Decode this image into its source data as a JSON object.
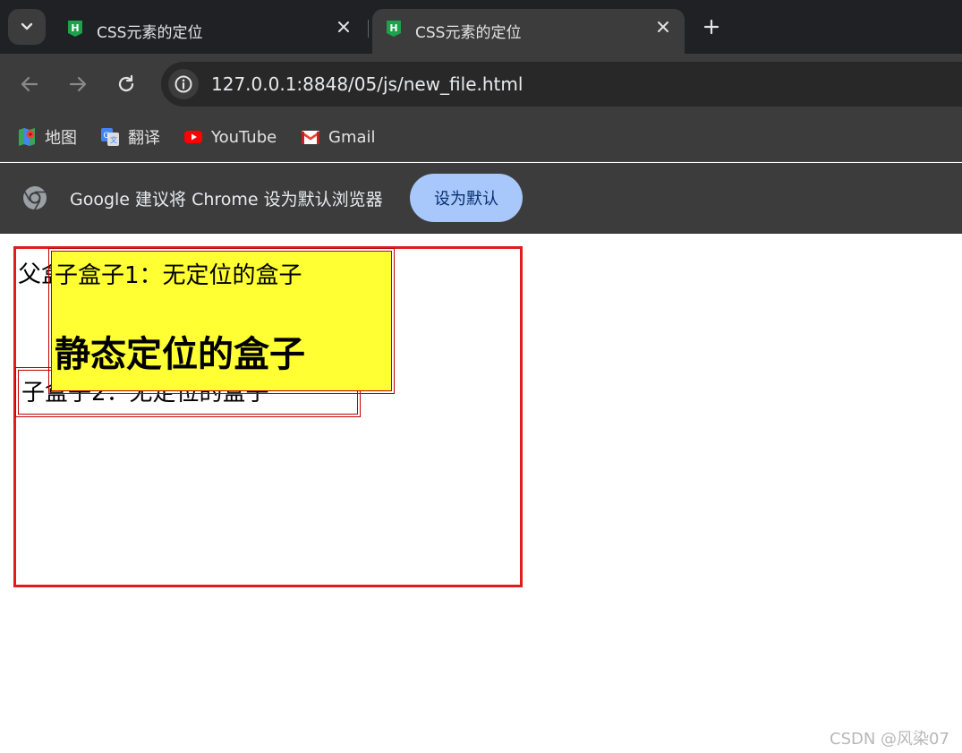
{
  "tabs": [
    {
      "title": "CSS元素的定位",
      "active": false
    },
    {
      "title": "CSS元素的定位",
      "active": true
    }
  ],
  "address_bar": {
    "url": "127.0.0.1:8848/05/js/new_file.html"
  },
  "bookmarks": [
    {
      "label": "地图",
      "icon": "maps-icon"
    },
    {
      "label": "翻译",
      "icon": "translate-icon"
    },
    {
      "label": "YouTube",
      "icon": "youtube-icon"
    },
    {
      "label": "Gmail",
      "icon": "gmail-icon"
    }
  ],
  "infobar": {
    "message": "Google 建议将 Chrome 设为默认浏览器",
    "button_label": "设为默认"
  },
  "page": {
    "parent_label": "父盒子",
    "child1_label": "子盒子1：无定位的盒子",
    "child1_heading": "静态定位的盒子",
    "child2_label": "子盒子2：无定位的盒子"
  },
  "watermark": "CSDN @风染07",
  "colors": {
    "tab_strip": "#202124",
    "toolbar": "#3c3c3c",
    "button_accent": "#a8c7fa",
    "parent_border": "#e21b1b",
    "child_border": "#c00000",
    "child1_background": "#ffff33"
  }
}
